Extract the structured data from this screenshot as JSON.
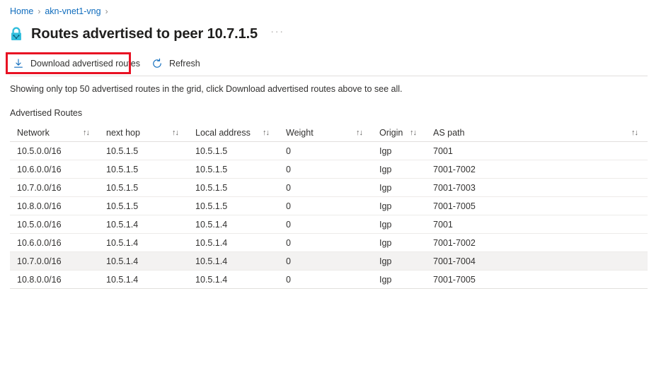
{
  "breadcrumb": {
    "items": [
      {
        "label": "Home"
      },
      {
        "label": "akn-vnet1-vng"
      }
    ],
    "separator": "›"
  },
  "header": {
    "icon": "vpn-gateway-lock-icon",
    "title": "Routes advertised to peer 10.7.1.5",
    "more_menu": "···"
  },
  "toolbar": {
    "download_label": "Download advertised routes",
    "download_icon": "download-arrow-icon",
    "refresh_label": "Refresh",
    "refresh_icon": "refresh-circular-arrow-icon",
    "highlight_color": "#e81123"
  },
  "notice": {
    "text": "Showing only top 50 advertised routes in the grid, click Download advertised routes above to see all."
  },
  "grid": {
    "caption": "Advertised Routes",
    "sort_glyph": "↑↓",
    "columns": [
      {
        "key": "network",
        "label": "Network",
        "sortable": true
      },
      {
        "key": "next_hop",
        "label": "next hop",
        "sortable": true
      },
      {
        "key": "local_address",
        "label": "Local address",
        "sortable": true
      },
      {
        "key": "weight",
        "label": "Weight",
        "sortable": true
      },
      {
        "key": "origin",
        "label": "Origin",
        "sortable": true
      },
      {
        "key": "as_path",
        "label": "AS path",
        "sortable": true
      }
    ],
    "rows": [
      {
        "network": "10.5.0.0/16",
        "next_hop": "10.5.1.5",
        "local_address": "10.5.1.5",
        "weight": "0",
        "origin": "Igp",
        "as_path": "7001",
        "highlighted": false
      },
      {
        "network": "10.6.0.0/16",
        "next_hop": "10.5.1.5",
        "local_address": "10.5.1.5",
        "weight": "0",
        "origin": "Igp",
        "as_path": "7001-7002",
        "highlighted": false
      },
      {
        "network": "10.7.0.0/16",
        "next_hop": "10.5.1.5",
        "local_address": "10.5.1.5",
        "weight": "0",
        "origin": "Igp",
        "as_path": "7001-7003",
        "highlighted": false
      },
      {
        "network": "10.8.0.0/16",
        "next_hop": "10.5.1.5",
        "local_address": "10.5.1.5",
        "weight": "0",
        "origin": "Igp",
        "as_path": "7001-7005",
        "highlighted": false
      },
      {
        "network": "10.5.0.0/16",
        "next_hop": "10.5.1.4",
        "local_address": "10.5.1.4",
        "weight": "0",
        "origin": "Igp",
        "as_path": "7001",
        "highlighted": false
      },
      {
        "network": "10.6.0.0/16",
        "next_hop": "10.5.1.4",
        "local_address": "10.5.1.4",
        "weight": "0",
        "origin": "Igp",
        "as_path": "7001-7002",
        "highlighted": false
      },
      {
        "network": "10.7.0.0/16",
        "next_hop": "10.5.1.4",
        "local_address": "10.5.1.4",
        "weight": "0",
        "origin": "Igp",
        "as_path": "7001-7004",
        "highlighted": true
      },
      {
        "network": "10.8.0.0/16",
        "next_hop": "10.5.1.4",
        "local_address": "10.5.1.4",
        "weight": "0",
        "origin": "Igp",
        "as_path": "7001-7005",
        "highlighted": false
      }
    ]
  },
  "colors": {
    "link": "#0f6cbd",
    "accent": "#0078d4",
    "icon_cyan": "#32bedd",
    "row_hover": "#f3f2f1",
    "border": "#e1dfdd"
  }
}
